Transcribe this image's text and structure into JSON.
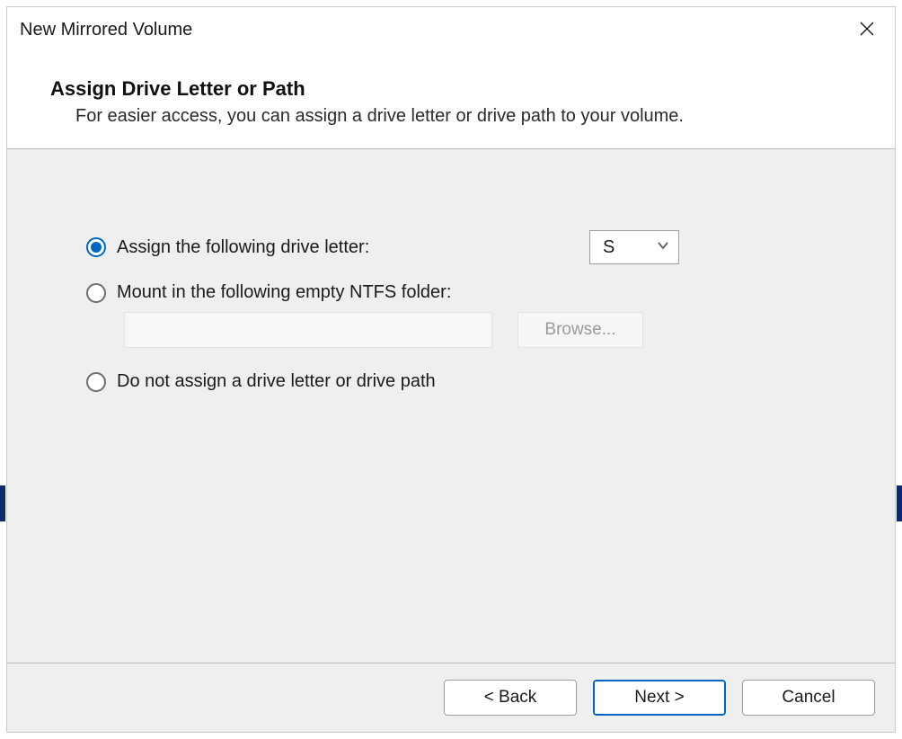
{
  "window": {
    "title": "New Mirrored Volume"
  },
  "header": {
    "heading": "Assign Drive Letter or Path",
    "subtext": "For easier access, you can assign a drive letter or drive path to your volume."
  },
  "options": {
    "assign_letter": {
      "label": "Assign the following drive letter:",
      "selected": true,
      "drive_value": "S"
    },
    "mount_folder": {
      "label": "Mount in the following empty NTFS folder:",
      "selected": false,
      "path_value": "",
      "browse_label": "Browse..."
    },
    "no_assign": {
      "label": "Do not assign a drive letter or drive path",
      "selected": false
    }
  },
  "footer": {
    "back_label": "< Back",
    "next_label": "Next >",
    "cancel_label": "Cancel"
  }
}
